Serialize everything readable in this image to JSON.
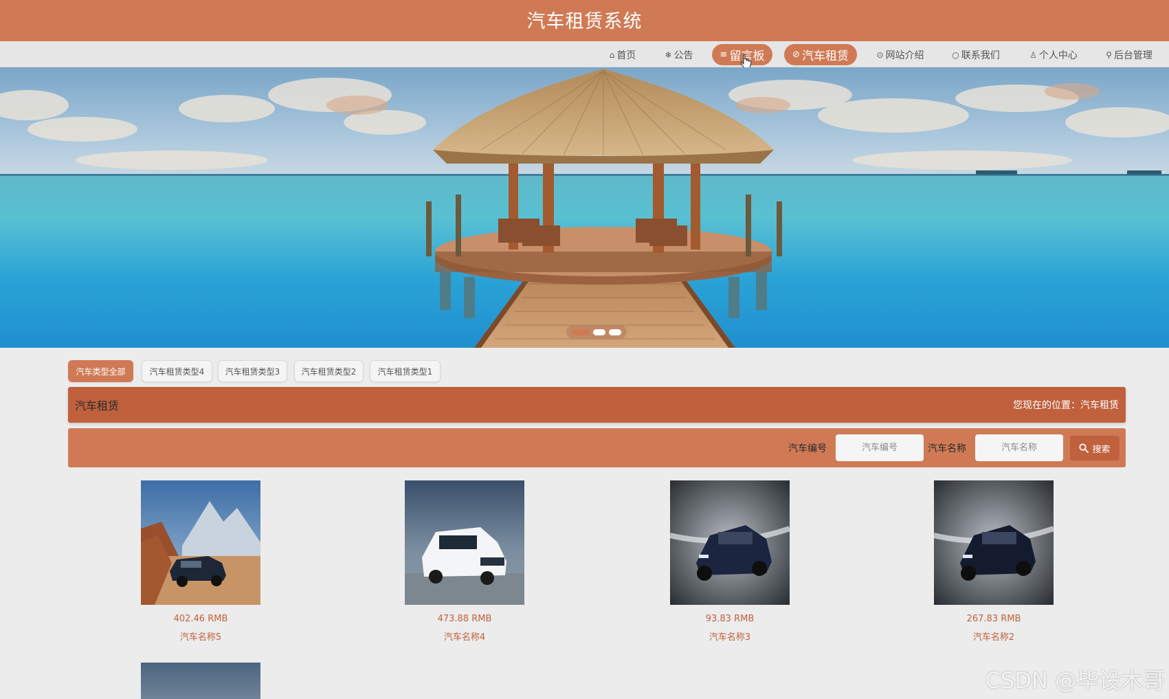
{
  "site": {
    "title": "汽车租赁系统"
  },
  "nav": {
    "items": [
      {
        "icon": "⌂",
        "label": "首页"
      },
      {
        "icon": "❄",
        "label": "公告"
      },
      {
        "icon": "≡",
        "label": "留言板"
      },
      {
        "icon": "⊘",
        "label": "汽车租赁"
      },
      {
        "icon": "⊙",
        "label": "网站介绍"
      },
      {
        "icon": "○",
        "label": "联系我们"
      },
      {
        "icon": "♙",
        "label": "个人中心"
      },
      {
        "icon": "⚲",
        "label": "后台管理"
      }
    ],
    "active_label": "汽车租赁",
    "hovered_label": "留言板"
  },
  "carousel": {
    "slide_count": 3,
    "active_index": 0
  },
  "filters": {
    "items": [
      "汽车类型全部",
      "汽车租赁类型4",
      "汽车租赁类型3",
      "汽车租赁类型2",
      "汽车租赁类型1"
    ],
    "active": "汽车类型全部"
  },
  "section": {
    "title": "汽车租赁",
    "breadcrumb": "您现在的位置：汽车租赁"
  },
  "search": {
    "car_no_label": "汽车编号",
    "car_no_placeholder": "汽车编号",
    "car_name_label": "汽车名称",
    "car_name_placeholder": "汽车名称",
    "button_label": "搜索",
    "button_icon": "search-icon"
  },
  "products": [
    {
      "price": "402.46 RMB",
      "name": "汽车名称5",
      "image": "dark-suv-desert-mountains"
    },
    {
      "price": "473.88 RMB",
      "name": "汽车名称4",
      "image": "white-mpv-coast"
    },
    {
      "price": "93.83 RMB",
      "name": "汽车名称3",
      "image": "dark-suv-studio"
    },
    {
      "price": "267.83 RMB",
      "name": "汽车名称2",
      "image": "dark-suv-studio"
    }
  ],
  "watermark": "CSDN @毕设木哥",
  "colors": {
    "primary": "#d07a55",
    "primary_dark": "#c0603d",
    "nav_bg": "#e6e6e6",
    "page_bg": "#ececec"
  }
}
